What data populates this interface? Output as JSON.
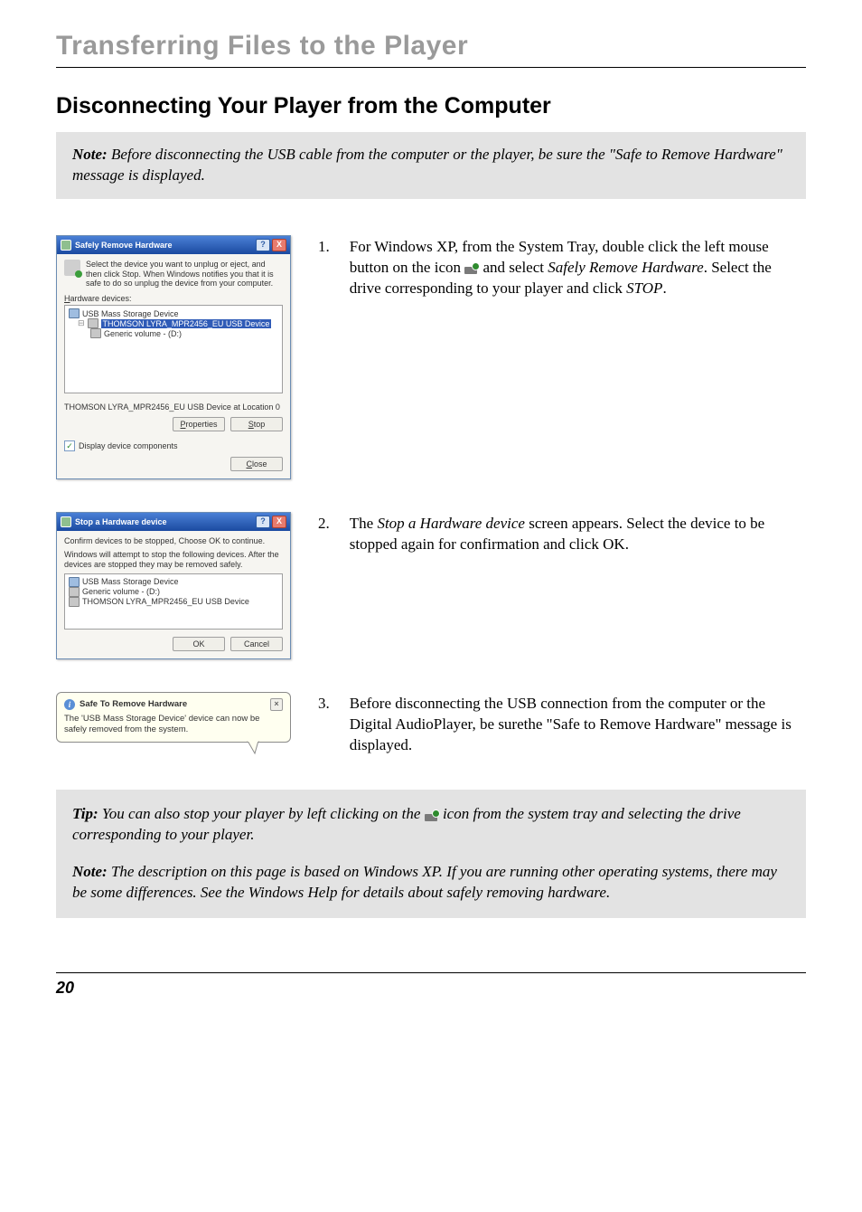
{
  "chapter_title": "Transferring Files to the Player",
  "section_title": "Disconnecting Your Player from the Computer",
  "top_note": {
    "label": "Note:",
    "text": " Before disconnecting the USB cable from the computer or the player, be sure the \"Safe to Remove Hardware\" message is displayed."
  },
  "dialog1": {
    "title": "Safely Remove Hardware",
    "help_btn": "?",
    "close_btn": "X",
    "intro": "Select the device you want to unplug or eject, and then click Stop. When Windows notifies you that it is safe to do so unplug the device from your computer.",
    "list_label_u": "H",
    "list_label_rest": "ardware devices:",
    "tree": {
      "root": "USB Mass Storage Device",
      "selected": "THOMSON LYRA_MPR2456_EU USB Device",
      "child": "Generic volume - (D:)"
    },
    "status": "THOMSON LYRA_MPR2456_EU USB Device at Location 0",
    "btn_properties_u": "P",
    "btn_properties_rest": "roperties",
    "btn_stop_u": "S",
    "btn_stop_rest": "top",
    "checkbox_u": "D",
    "checkbox_rest": "isplay device components",
    "btn_close_u": "C",
    "btn_close_rest": "lose"
  },
  "step1": {
    "num": "1.",
    "pre": "For Windows XP, from the System Tray, double click the left mouse button on the icon ",
    "mid": " and select ",
    "italic1": "Safely Remove Hardware",
    "post1": ". Select the drive corresponding to your player and click ",
    "italic2": "STOP",
    "post2": "."
  },
  "dialog2": {
    "title": "Stop a Hardware device",
    "help_btn": "?",
    "close_btn": "X",
    "line1": "Confirm devices to be stopped, Choose OK to continue.",
    "line2": "Windows will attempt to stop the following devices. After the devices are stopped they may be removed safely.",
    "list": {
      "item1": "USB Mass Storage Device",
      "item2": "Generic volume - (D:)",
      "item3": "THOMSON LYRA_MPR2456_EU USB Device"
    },
    "btn_ok": "OK",
    "btn_cancel": "Cancel"
  },
  "step2": {
    "num": "2.",
    "pre": "The ",
    "italic1": "Stop a Hardware device",
    "post": " screen appears. Select the device to be stopped again for confirmation and click OK."
  },
  "balloon": {
    "title": "Safe To Remove Hardware",
    "close": "×",
    "body": "The 'USB Mass Storage Device' device can now be safely removed from the system."
  },
  "step3": {
    "num": "3.",
    "text": "Before disconnecting the USB connection from the computer or the Digital AudioPlayer, be surethe \"Safe to Remove Hardware\" message is displayed."
  },
  "tip": {
    "label": "Tip:",
    "pre": " You can also stop your player by left clicking on the ",
    "post": " icon from the system tray and selecting the drive corresponding to your player."
  },
  "bottom_note": {
    "label": "Note:",
    "text": " The description on this page is based on Windows XP. If you are running other operating systems, there may be some differences. See the Windows Help for details about safely removing hardware."
  },
  "page_number": "20"
}
